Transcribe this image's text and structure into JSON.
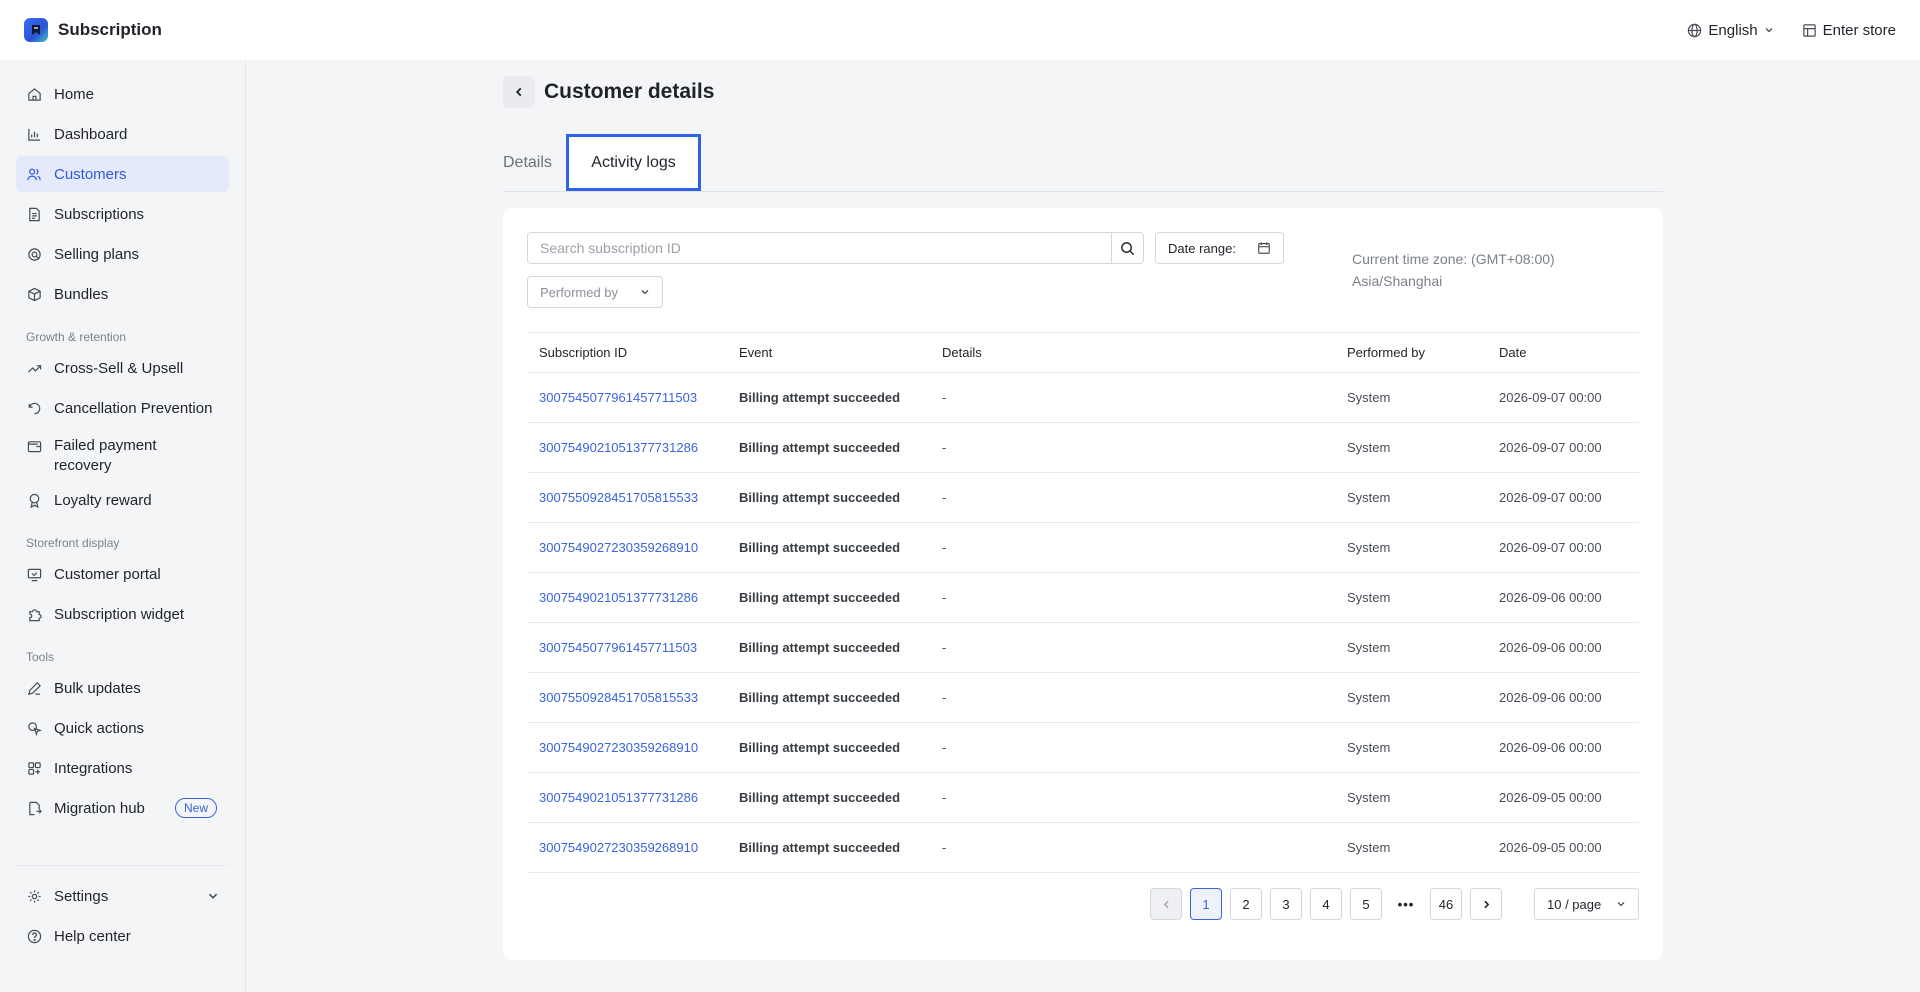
{
  "app": {
    "title": "Subscription"
  },
  "topbar": {
    "language": "English",
    "enter_store": "Enter store"
  },
  "sidebar": {
    "main_items": [
      {
        "label": "Home",
        "icon": "home-icon"
      },
      {
        "label": "Dashboard",
        "icon": "bar-chart-icon"
      },
      {
        "label": "Customers",
        "icon": "users-icon",
        "active": true
      },
      {
        "label": "Subscriptions",
        "icon": "document-icon"
      },
      {
        "label": "Selling plans",
        "icon": "tag-icon"
      },
      {
        "label": "Bundles",
        "icon": "box-icon"
      }
    ],
    "growth_label": "Growth & retention",
    "growth_items": [
      {
        "label": "Cross-Sell & Upsell",
        "icon": "trend-up-icon"
      },
      {
        "label": "Cancellation Prevention",
        "icon": "rotate-icon"
      },
      {
        "label": "Failed payment recovery",
        "icon": "wallet-icon"
      },
      {
        "label": "Loyalty reward",
        "icon": "medal-icon"
      }
    ],
    "storefront_label": "Storefront display",
    "storefront_items": [
      {
        "label": "Customer portal",
        "icon": "monitor-icon"
      },
      {
        "label": "Subscription widget",
        "icon": "puzzle-icon"
      }
    ],
    "tools_label": "Tools",
    "tools_items": [
      {
        "label": "Bulk updates",
        "icon": "edit-icon"
      },
      {
        "label": "Quick actions",
        "icon": "pointer-icon"
      },
      {
        "label": "Integrations",
        "icon": "grid-icon"
      },
      {
        "label": "Migration hub",
        "icon": "migrate-icon",
        "badge": "New"
      }
    ],
    "bottom_items": [
      {
        "label": "Settings",
        "icon": "gear-icon"
      },
      {
        "label": "Help center",
        "icon": "help-icon"
      }
    ]
  },
  "page": {
    "title": "Customer details",
    "tabs": {
      "details": "Details",
      "activity": "Activity logs"
    }
  },
  "filters": {
    "search_placeholder": "Search subscription ID",
    "date_range_label": "Date range:",
    "performed_by_label": "Performed by",
    "timezone_line1": "Current time zone: (GMT+08:00)",
    "timezone_line2": "Asia/Shanghai"
  },
  "table": {
    "columns": {
      "subscription_id": "Subscription ID",
      "event": "Event",
      "details": "Details",
      "performed_by": "Performed by",
      "date": "Date"
    },
    "rows": [
      {
        "id": "3007545077961457711503",
        "event": "Billing attempt succeeded",
        "details": "-",
        "performed_by": "System",
        "date": "2026-09-07 00:00"
      },
      {
        "id": "3007549021051377731286",
        "event": "Billing attempt succeeded",
        "details": "-",
        "performed_by": "System",
        "date": "2026-09-07 00:00"
      },
      {
        "id": "3007550928451705815533",
        "event": "Billing attempt succeeded",
        "details": "-",
        "performed_by": "System",
        "date": "2026-09-07 00:00"
      },
      {
        "id": "3007549027230359268910",
        "event": "Billing attempt succeeded",
        "details": "-",
        "performed_by": "System",
        "date": "2026-09-07 00:00"
      },
      {
        "id": "3007549021051377731286",
        "event": "Billing attempt succeeded",
        "details": "-",
        "performed_by": "System",
        "date": "2026-09-06 00:00"
      },
      {
        "id": "3007545077961457711503",
        "event": "Billing attempt succeeded",
        "details": "-",
        "performed_by": "System",
        "date": "2026-09-06 00:00"
      },
      {
        "id": "3007550928451705815533",
        "event": "Billing attempt succeeded",
        "details": "-",
        "performed_by": "System",
        "date": "2026-09-06 00:00"
      },
      {
        "id": "3007549027230359268910",
        "event": "Billing attempt succeeded",
        "details": "-",
        "performed_by": "System",
        "date": "2026-09-06 00:00"
      },
      {
        "id": "3007549021051377731286",
        "event": "Billing attempt succeeded",
        "details": "-",
        "performed_by": "System",
        "date": "2026-09-05 00:00"
      },
      {
        "id": "3007549027230359268910",
        "event": "Billing attempt succeeded",
        "details": "-",
        "performed_by": "System",
        "date": "2026-09-05 00:00"
      }
    ]
  },
  "pagination": {
    "pages": [
      "1",
      "2",
      "3",
      "4",
      "5"
    ],
    "current": "1",
    "ellipsis": "•••",
    "last": "46",
    "page_size": "10 / page"
  },
  "colors": {
    "accent": "#3a63dc",
    "active_bg": "#e4e9fb",
    "tab_highlight": "#2f62e8"
  }
}
